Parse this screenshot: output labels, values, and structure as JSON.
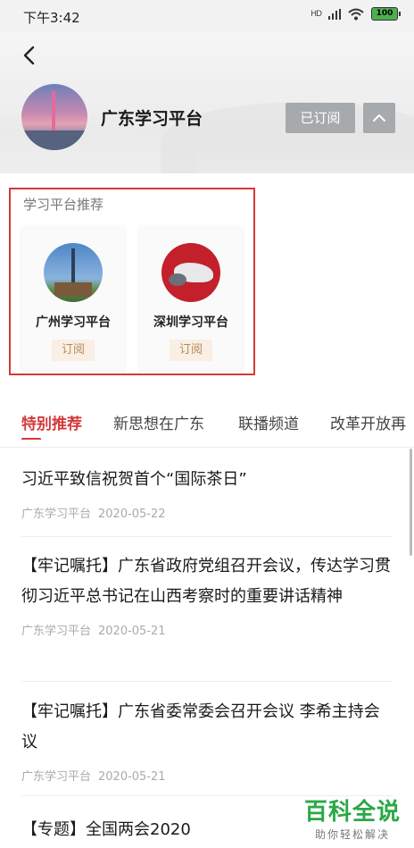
{
  "status_bar": {
    "time": "下午3:42",
    "signal": "HD",
    "battery": "100"
  },
  "header": {
    "title": "广东学习平台",
    "subscribed_label": "已订阅"
  },
  "recommend": {
    "title": "学习平台推荐",
    "items": [
      {
        "name": "广州学习平台",
        "subscribe_label": "订阅"
      },
      {
        "name": "深圳学习平台",
        "subscribe_label": "订阅"
      }
    ]
  },
  "tabs": [
    {
      "label": "特别推荐",
      "active": true
    },
    {
      "label": "新思想在广东"
    },
    {
      "label": "联播频道"
    },
    {
      "label": "改革开放再"
    }
  ],
  "news": [
    {
      "title": "习近平致信祝贺首个“国际茶日”",
      "source": "广东学习平台",
      "date": "2020-05-22"
    },
    {
      "title": "【牢记嘱托】广东省政府党组召开会议，传达学习贯彻习近平总书记在山西考察时的重要讲话精神",
      "source": "广东学习平台",
      "date": "2020-05-21"
    },
    {
      "title": "【牢记嘱托】广东省委常委会召开会议 李希主持会议",
      "source": "广东学习平台",
      "date": "2020-05-21"
    },
    {
      "title": "【专题】全国两会2020"
    }
  ],
  "watermark": {
    "main": "百科全说",
    "sub": "助你轻松解决"
  },
  "colors": {
    "accent": "#d33a3a",
    "subscribed_bg": "#a7aaad",
    "subscribe_text": "#b88a5a",
    "watermark": "#2aa845"
  }
}
